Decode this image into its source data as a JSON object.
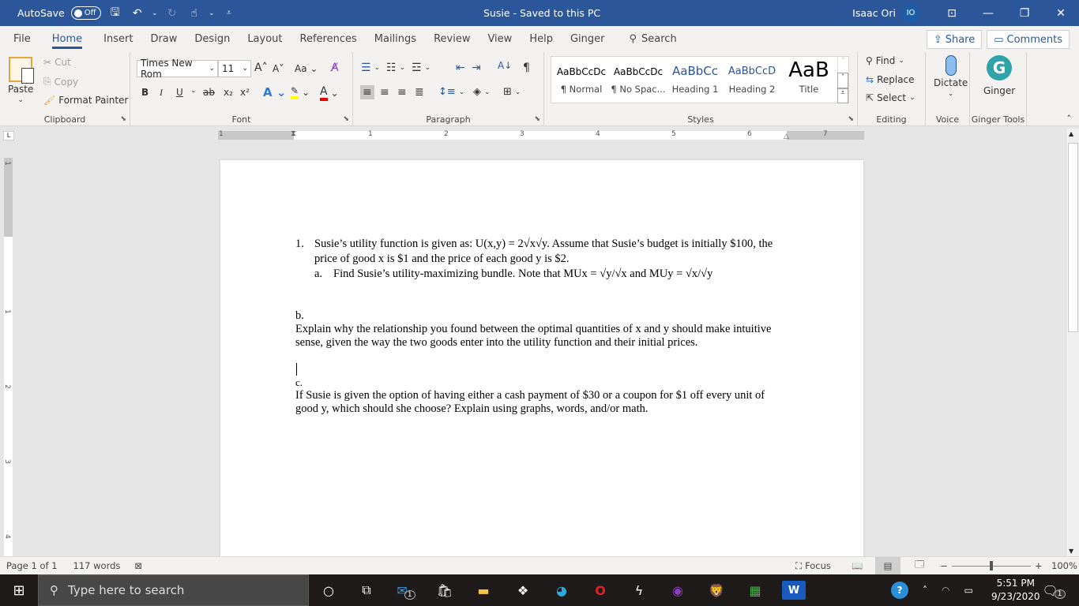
{
  "titlebar": {
    "autosave_label": "AutoSave",
    "autosave_state": "Off",
    "doc_title": "Susie  -  Saved to this PC",
    "user_name": "Isaac Ori",
    "user_initials": "IO"
  },
  "menu": {
    "tabs": [
      "File",
      "Home",
      "Insert",
      "Draw",
      "Design",
      "Layout",
      "References",
      "Mailings",
      "Review",
      "View",
      "Help",
      "Ginger"
    ],
    "active": "Home",
    "search_label": "Search",
    "share_label": "Share",
    "comments_label": "Comments"
  },
  "ribbon": {
    "clipboard": {
      "label": "Clipboard",
      "paste": "Paste",
      "cut": "Cut",
      "copy": "Copy",
      "format_painter": "Format Painter"
    },
    "font": {
      "label": "Font",
      "font_name": "Times New Rom",
      "font_size": "11"
    },
    "paragraph": {
      "label": "Paragraph"
    },
    "styles": {
      "label": "Styles",
      "items": [
        {
          "preview": "AaBbCcDc",
          "name": "¶ Normal"
        },
        {
          "preview": "AaBbCcDc",
          "name": "¶ No Spac..."
        },
        {
          "preview": "AaBbCc",
          "name": "Heading 1"
        },
        {
          "preview": "AaBbCcD",
          "name": "Heading 2"
        },
        {
          "preview": "AaB",
          "name": "Title"
        }
      ]
    },
    "editing": {
      "label": "Editing",
      "find": "Find",
      "replace": "Replace",
      "select": "Select"
    },
    "voice": {
      "label": "Voice",
      "dictate": "Dictate"
    },
    "ginger": {
      "label": "Ginger Tools",
      "ginger": "Ginger"
    }
  },
  "ruler": {
    "h_numbers": [
      "1",
      "1",
      "2",
      "3",
      "4",
      "5",
      "6",
      "7"
    ],
    "v_numbers": [
      "1",
      "1",
      "2",
      "3",
      "4"
    ]
  },
  "document": {
    "q1_num": "1.",
    "q1_line1": "Susie’s utility function is given as: U(x,y) = 2√x√y. Assume that Susie’s budget is initially $100, the",
    "q1_line2": "price of good x is $1 and the price of each good y is $2.",
    "qa_num": "a.",
    "qa_text": "Find Susie’s utility-maximizing bundle. Note that MUx = √y/√x  and  MUy = √x/√y",
    "qb_label": "b.",
    "qb_line1": "Explain why the relationship you found between the optimal quantities of x and y should make intuitive",
    "qb_line2": "sense, given the way the two goods enter into the utility function and their initial prices.",
    "qc_label": "c.",
    "qc_line1": "If Susie is given the option of having either a cash payment of $30 or a coupon for $1 off every unit of",
    "qc_line2": "good y, which should she choose? Explain using graphs, words, and/or math."
  },
  "status": {
    "page": "Page 1 of 1",
    "words": "117 words",
    "focus": "Focus",
    "zoom": "100%",
    "zoom_level_percent": 100
  },
  "taskbar": {
    "search_placeholder": "Type here to search",
    "mail_badge": "1",
    "time": "5:51 PM",
    "date": "9/23/2020",
    "notif_badge": "1"
  }
}
